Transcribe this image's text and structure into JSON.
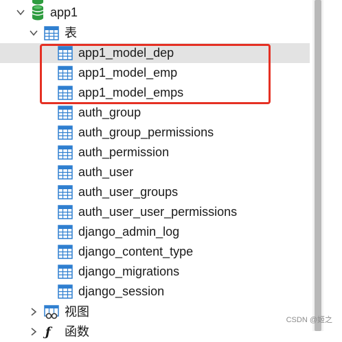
{
  "tree": {
    "database": {
      "label": "app1"
    },
    "tables_group": {
      "label": "表"
    },
    "tables": [
      {
        "label": "app1_model_dep"
      },
      {
        "label": "app1_model_emp"
      },
      {
        "label": "app1_model_emps"
      },
      {
        "label": "auth_group"
      },
      {
        "label": "auth_group_permissions"
      },
      {
        "label": "auth_permission"
      },
      {
        "label": "auth_user"
      },
      {
        "label": "auth_user_groups"
      },
      {
        "label": "auth_user_user_permissions"
      },
      {
        "label": "django_admin_log"
      },
      {
        "label": "django_content_type"
      },
      {
        "label": "django_migrations"
      },
      {
        "label": "django_session"
      }
    ],
    "views_group": {
      "label": "视图"
    },
    "functions_group": {
      "label": "函数"
    }
  },
  "watermark": "CSDN @姬之",
  "colors": {
    "selection": "#e3e3e3",
    "highlight_border": "#e53023",
    "table_icon": "#2f7fd0",
    "database_icon": "#2e9c3f"
  },
  "icons": {
    "expand": "chevron-down-icon",
    "collapse": "chevron-right-icon",
    "table": "table-icon",
    "database": "database-icon",
    "view": "view-icon",
    "function": "function-icon"
  }
}
